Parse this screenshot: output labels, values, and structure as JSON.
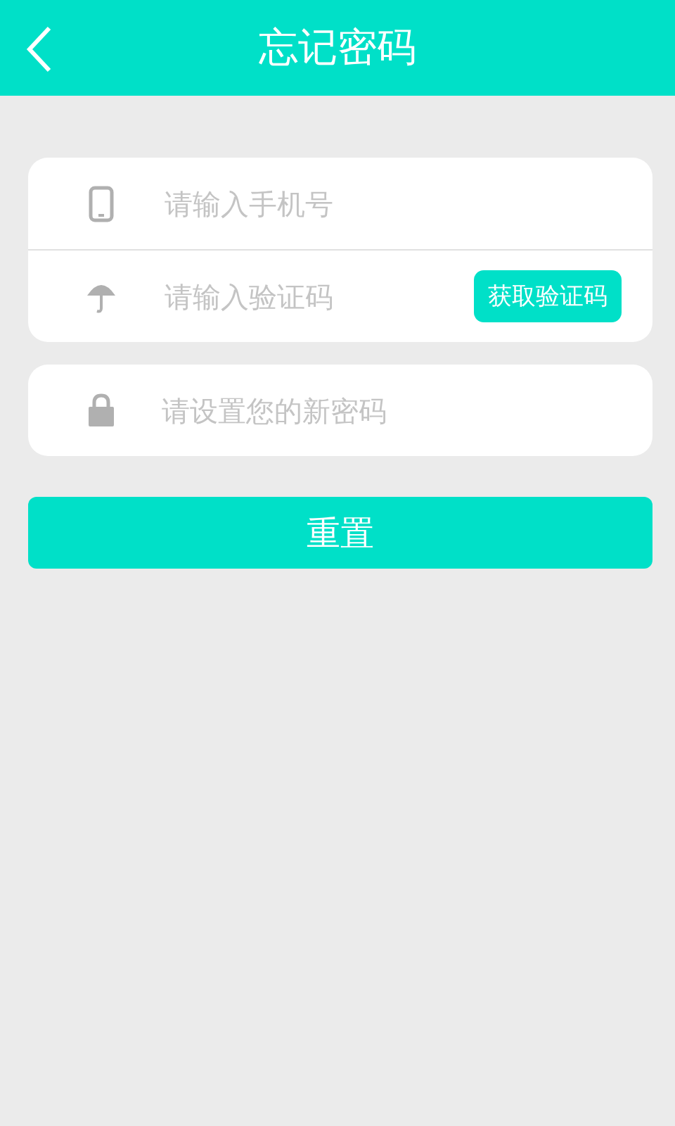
{
  "header": {
    "title": "忘记密码"
  },
  "fields": [
    {
      "kind": "phone",
      "placeholder": "请输入手机号"
    },
    {
      "kind": "code",
      "placeholder": "请输入验证码",
      "button": "获取验证码"
    }
  ],
  "password": {
    "placeholder": "请设置您的新密码"
  },
  "submit": "重置"
}
